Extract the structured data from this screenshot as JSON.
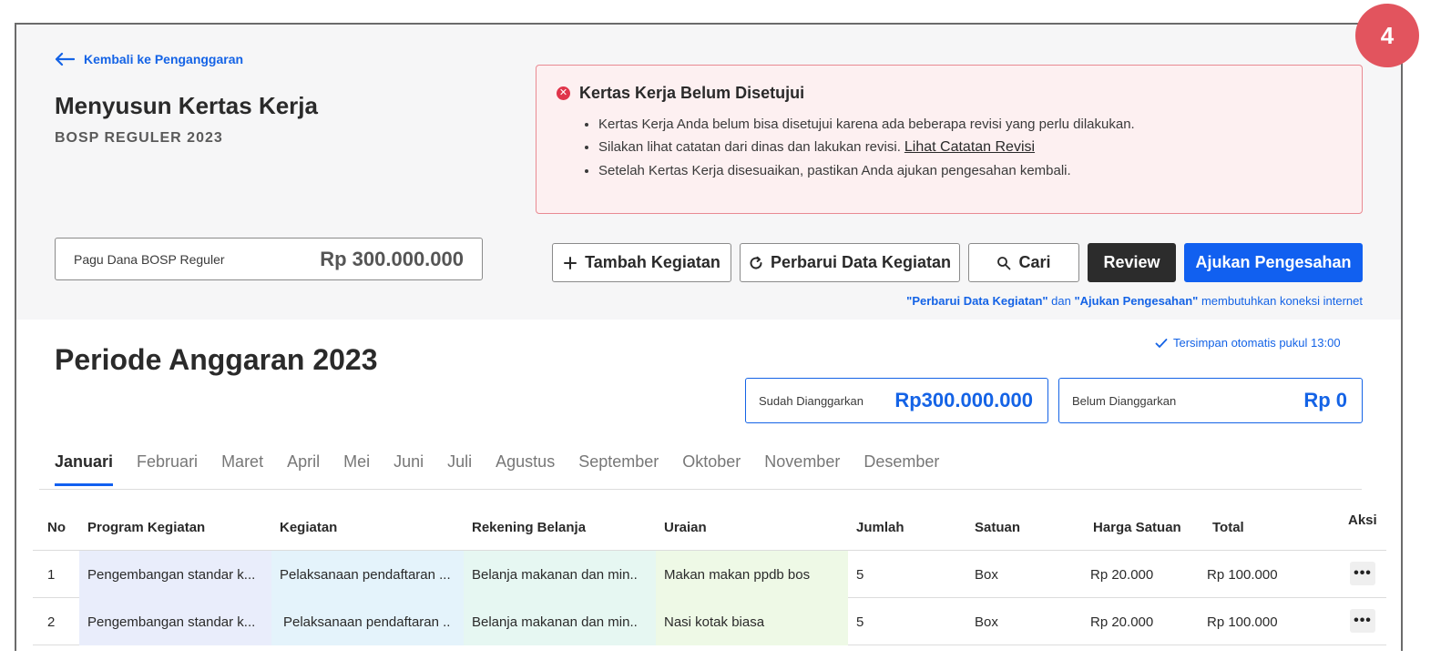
{
  "step_badge": "4",
  "back_link": "Kembali ke Penganggaran",
  "page_title": "Menyusun Kertas Kerja",
  "page_subtitle": "BOSP REGULER 2023",
  "alert": {
    "title": "Kertas Kerja Belum Disetujui",
    "items": [
      "Kertas Kerja Anda belum bisa disetujui karena ada beberapa revisi yang perlu dilakukan.",
      "Silakan lihat catatan dari dinas dan lakukan revisi.",
      "Setelah Kertas Kerja disesuaikan, pastikan Anda ajukan pengesahan kembali."
    ],
    "link": "Lihat Catatan Revisi"
  },
  "pagu": {
    "label": "Pagu Dana BOSP Reguler",
    "value": "Rp 300.000.000"
  },
  "toolbar": {
    "add": "Tambah Kegiatan",
    "refresh": "Perbarui Data Kegiatan",
    "search": "Cari",
    "review": "Review",
    "submit": "Ajukan Pengesahan"
  },
  "connection_note": {
    "part1": "\"Perbarui Data Kegiatan\"",
    "part2": " dan ",
    "part3": "\"Ajukan Pengesahan\"",
    "part4": " membutuhkan koneksi internet"
  },
  "autosave": "Tersimpan otomatis pukul 13:00",
  "period_title": "Periode Anggaran 2023",
  "summary": {
    "budgeted_label": "Sudah Dianggarkan",
    "budgeted_value": "Rp300.000.000",
    "unbudgeted_label": "Belum Dianggarkan",
    "unbudgeted_value": "Rp 0"
  },
  "months": [
    "Januari",
    "Februari",
    "Maret",
    "April",
    "Mei",
    "Juni",
    "Juli",
    "Agustus",
    "September",
    "Oktober",
    "November",
    "Desember"
  ],
  "active_month": "Januari",
  "table": {
    "headers": {
      "no": "No",
      "program": "Program Kegiatan",
      "kegiatan": "Kegiatan",
      "rekening": "Rekening Belanja",
      "uraian": "Uraian",
      "jumlah": "Jumlah",
      "satuan": "Satuan",
      "harga": "Harga Satuan",
      "total": "Total",
      "aksi": "Aksi"
    },
    "rows": [
      {
        "no": "1",
        "program": "Pengembangan standar k...",
        "kegiatan": "Pelaksanaan pendaftaran ...",
        "rekening": "Belanja makanan dan min..",
        "uraian": "Makan makan ppdb bos",
        "jumlah": "5",
        "satuan": "Box",
        "harga": "Rp 20.000",
        "total": "Rp 100.000",
        "aksi": "•••"
      },
      {
        "no": "2",
        "program": "Pengembangan standar k...",
        "kegiatan": "Pelaksanaan pendaftaran ..",
        "rekening": "Belanja makanan dan min..",
        "uraian": "Nasi kotak biasa",
        "jumlah": "5",
        "satuan": "Box",
        "harga": "Rp 20.000",
        "total": "Rp 100.000",
        "aksi": "•••"
      }
    ]
  }
}
